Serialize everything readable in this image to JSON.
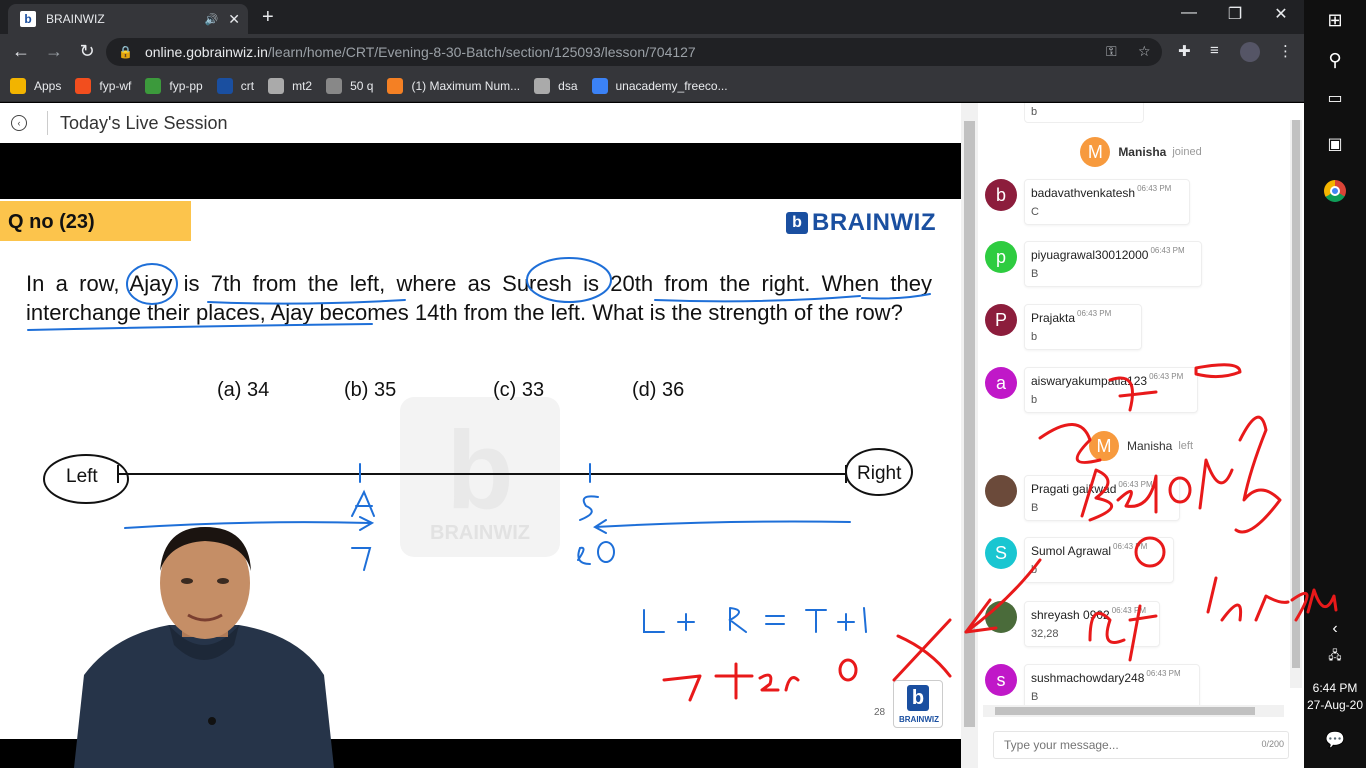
{
  "browser": {
    "tab_title": "BRAINWIZ",
    "new_tab": "+",
    "url_host": "online.gobrainwiz.in",
    "url_path": "/learn/home/CRT/Evening-8-30-Batch/section/125093/lesson/704127",
    "bookmarks": [
      {
        "label": "Apps",
        "color": "#f2b400"
      },
      {
        "label": "fyp-wf",
        "color": "#f24e1e"
      },
      {
        "label": "fyp-pp",
        "color": "#3c9a3c"
      },
      {
        "label": "crt",
        "color": "#1a4fa0"
      },
      {
        "label": "mt2",
        "color": "#aaaaaa"
      },
      {
        "label": "50 q",
        "color": "#888888"
      },
      {
        "label": "(1) Maximum Num...",
        "color": "#f48024"
      },
      {
        "label": "dsa",
        "color": "#aaaaaa"
      },
      {
        "label": "unacademy_freeco...",
        "color": "#3b82f6"
      }
    ]
  },
  "page": {
    "title": "Today's Live Session"
  },
  "slide": {
    "qno": "Q no (23)",
    "brand": "BRAINWIZ",
    "question": "In a row, Ajay is 7th from the left, where as Suresh is 20th from the right. When they interchange their places, Ajay becomes 14th from the left. What is the strength of the row?",
    "options": [
      "(a) 34",
      "(b) 35",
      "(c) 33",
      "(d) 36"
    ],
    "left_label": "Left",
    "right_label": "Right",
    "watermark": "BRAINWIZ",
    "watermark_letter": "b",
    "page_number": "28",
    "logo_small": "BRAINWIZ"
  },
  "chat": {
    "join_manisha": {
      "name": "Manisha",
      "action": "joined",
      "initial": "M"
    },
    "left_manisha": {
      "name": "Manisha",
      "action": "left",
      "initial": "M"
    },
    "messages": [
      {
        "initial": "b",
        "name": "badavathvenkatesh",
        "time": "06:43 PM",
        "text": "C",
        "color": "#8c1d3c"
      },
      {
        "initial": "p",
        "name": "piyuagrawal30012000",
        "time": "06:43 PM",
        "text": "B",
        "color": "#2ecc40"
      },
      {
        "initial": "P",
        "name": "Prajakta",
        "time": "06:43 PM",
        "text": "b",
        "color": "#8c1d3c"
      },
      {
        "initial": "a",
        "name": "aiswaryakumpatla123",
        "time": "06:43 PM",
        "text": "b",
        "color": "#c018c8"
      },
      {
        "initial": "",
        "name": "Pragati gaikwad",
        "time": "06:43 PM",
        "text": "B",
        "color": "#6b4a3a"
      },
      {
        "initial": "S",
        "name": "Sumol Agrawal",
        "time": "06:43 PM",
        "text": "b",
        "color": "#19c6d1"
      },
      {
        "initial": "",
        "name": "shreyash 0902",
        "time": "06:43 PM",
        "text": "32,28",
        "color": "#4a6b3a"
      },
      {
        "initial": "s",
        "name": "sushmachowdary248",
        "time": "06:43 PM",
        "text": "B",
        "color": "#c018c8"
      }
    ],
    "top_partial_text": "b",
    "input_placeholder": "Type your message...",
    "input_counter": "0/200"
  },
  "taskbar": {
    "time": "6:44 PM",
    "date": "27-Aug-20"
  },
  "ink": {
    "red": "#e8191a",
    "blue": "#1e6fd8",
    "board_formula": "L + R = T + 1"
  }
}
